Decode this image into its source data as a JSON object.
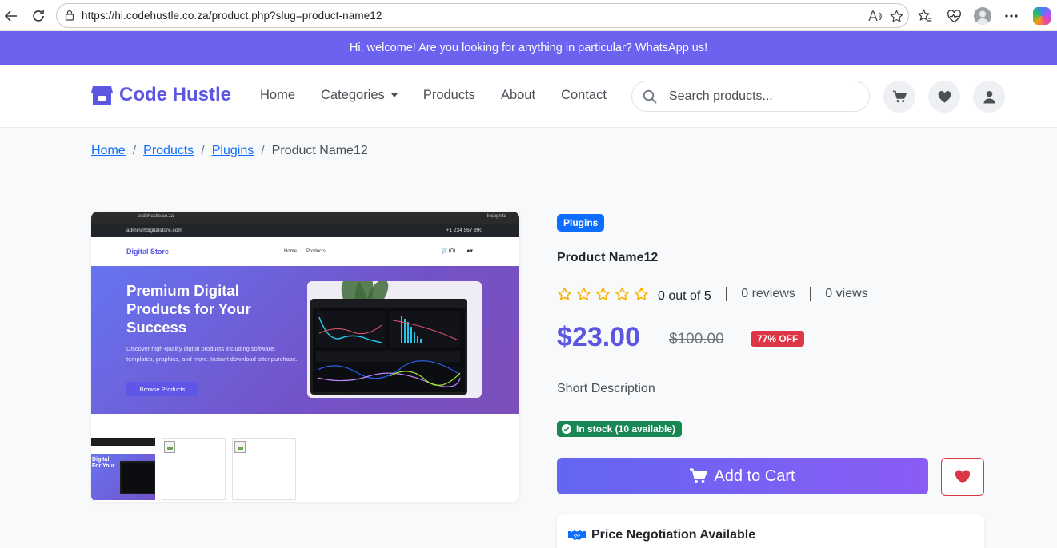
{
  "browser": {
    "url": "https://hi.codehustle.co.za/product.php?slug=product-name12"
  },
  "promo": {
    "text": "Hi, welcome! Are you looking for anything in particular? WhatsApp us!"
  },
  "header": {
    "brand": "Code Hustle",
    "nav": [
      "Home",
      "Categories",
      "Products",
      "About",
      "Contact"
    ],
    "search_placeholder": "Search products..."
  },
  "breadcrumb": {
    "items": [
      "Home",
      "Products",
      "Plugins"
    ],
    "current": "Product Name12",
    "separator": "/"
  },
  "gallery": {
    "preview": {
      "url": "codehustle.co.za",
      "incognito": "Incognito",
      "email": "admin@digitalstore.com",
      "phone": "+1 234 567 890",
      "logo": "Digital Store",
      "links": [
        "Home",
        "Products"
      ],
      "cart": "(0)",
      "hero_title": "Premium Digital Products for Your Success",
      "hero_text": "Discover high-quality digital products including software, templates, graphics, and more. Instant download after purchase.",
      "hero_button": "Browse Products"
    },
    "thumb_text": "Digital\nFor Your"
  },
  "product": {
    "category": "Plugins",
    "name": "Product Name12",
    "rating": 0,
    "rating_max": 5,
    "rating_text": "0 out of 5",
    "reviews": "0 reviews",
    "views": "0 views",
    "price": "$23.00",
    "old_price": "$100.00",
    "discount": "77% OFF",
    "short_description": "Short Description",
    "stock": "In stock (10 available)",
    "add_to_cart": "Add to Cart",
    "negotiation": "Price Negotiation Available"
  },
  "colors": {
    "primary": "#5b57e0",
    "promo_bg": "#6b63f0",
    "star": "#f5b50a",
    "danger": "#dc3545",
    "success": "#198754",
    "link": "#0d6efd"
  }
}
